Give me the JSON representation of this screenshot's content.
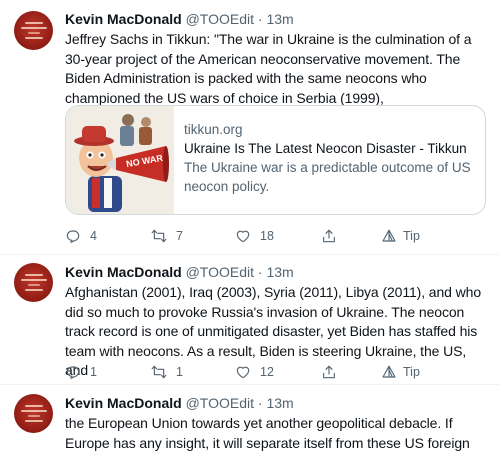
{
  "tweets": [
    {
      "author_name": "Kevin MacDonald",
      "author_handle": "@TOOEdit",
      "dot": "·",
      "time": "13m",
      "text": "Jeffrey Sachs in Tikkun: \"The war in Ukraine is the culmination of a 30-year project of the American neoconservative movement. The Biden Administration is packed with the same neocons who championed the US wars of choice in Serbia (1999),",
      "card": {
        "domain": "tikkun.org",
        "title": "Ukraine Is The Latest Neocon Disaster - Tikkun",
        "description": "The Ukraine war is a predictable outcome of US neocon policy.",
        "image_sign_text": "NO WAR"
      },
      "replies": "4",
      "retweets": "7",
      "likes": "18",
      "tip_label": "Tip"
    },
    {
      "author_name": "Kevin MacDonald",
      "author_handle": "@TOOEdit",
      "dot": "·",
      "time": "13m",
      "text": "Afghanistan (2001), Iraq (2003), Syria (2011), Libya (2011), and who did so much to provoke Russia's invasion of Ukraine. The neocon track record is one of unmitigated disaster, yet Biden has staffed his team with neocons. As a result, Biden is steering Ukraine, the US, and",
      "replies": "1",
      "retweets": "1",
      "likes": "12",
      "tip_label": "Tip"
    },
    {
      "author_name": "Kevin MacDonald",
      "author_handle": "@TOOEdit",
      "dot": "·",
      "time": "13m",
      "text": "the European Union towards yet another geopolitical debacle. If Europe has any insight, it will separate itself from these US foreign policy debacles."
    }
  ],
  "icons": {
    "reply": "reply-icon",
    "retweet": "retweet-icon",
    "like": "heart-icon",
    "share": "share-icon",
    "tip": "tip-icon"
  },
  "colors": {
    "text": "#0f1419",
    "secondary": "#536471",
    "border": "#cfd9de",
    "avatar": "#a8231a"
  }
}
